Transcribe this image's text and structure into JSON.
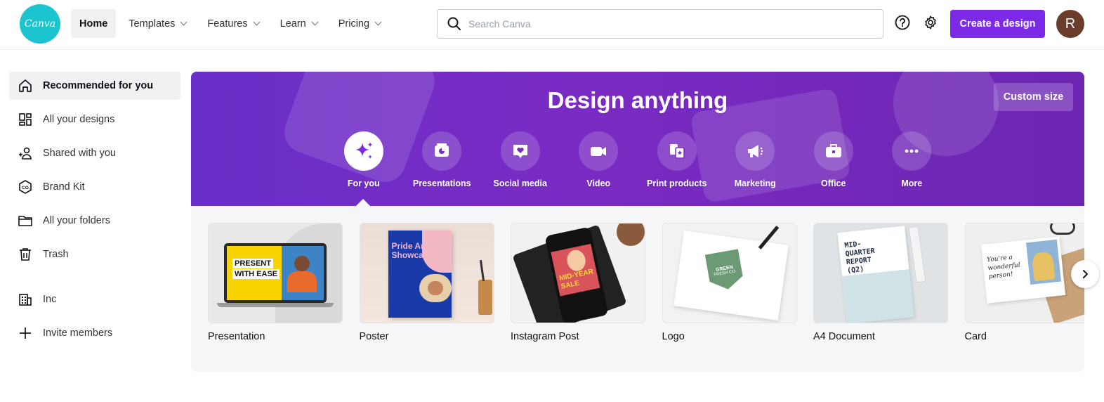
{
  "topbar": {
    "logo_text": "Canva",
    "nav": [
      {
        "label": "Home",
        "active": true,
        "dropdown": false
      },
      {
        "label": "Templates",
        "active": false,
        "dropdown": true
      },
      {
        "label": "Features",
        "active": false,
        "dropdown": true
      },
      {
        "label": "Learn",
        "active": false,
        "dropdown": true
      },
      {
        "label": "Pricing",
        "active": false,
        "dropdown": true
      }
    ],
    "search_placeholder": "Search Canva",
    "help_icon": "question-circle-icon",
    "settings_icon": "gear-icon",
    "create_button": "Create a design",
    "avatar_initial": "R",
    "accent_color": "#7d2ae8"
  },
  "sidebar": {
    "items": [
      {
        "label": "Recommended for you",
        "icon": "home-icon",
        "active": true
      },
      {
        "label": "All your designs",
        "icon": "grid-icon",
        "active": false
      },
      {
        "label": "Shared with you",
        "icon": "shared-users-icon",
        "active": false
      },
      {
        "label": "Brand Kit",
        "icon": "brand-kit-icon",
        "active": false
      },
      {
        "label": "All your folders",
        "icon": "folder-icon",
        "active": false
      },
      {
        "label": "Trash",
        "icon": "trash-icon",
        "active": false
      }
    ],
    "team": [
      {
        "label": "Inc",
        "icon": "building-icon"
      },
      {
        "label": "Invite members",
        "icon": "plus-icon"
      }
    ]
  },
  "hero": {
    "title": "Design anything",
    "custom_size": "Custom size",
    "categories": [
      {
        "label": "For you",
        "icon": "sparkle-icon",
        "active": true
      },
      {
        "label": "Presentations",
        "icon": "presentation-icon",
        "active": false
      },
      {
        "label": "Social media",
        "icon": "heart-bubble-icon",
        "active": false
      },
      {
        "label": "Video",
        "icon": "video-camera-icon",
        "active": false
      },
      {
        "label": "Print products",
        "icon": "print-icon",
        "active": false
      },
      {
        "label": "Marketing",
        "icon": "megaphone-icon",
        "active": false
      },
      {
        "label": "Office",
        "icon": "briefcase-icon",
        "active": false
      },
      {
        "label": "More",
        "icon": "more-dots-icon",
        "active": false
      }
    ]
  },
  "templates": {
    "cards": [
      {
        "label": "Presentation",
        "thumb_text": [
          "PRESENT",
          "WITH EASE"
        ]
      },
      {
        "label": "Poster",
        "thumb_text": [
          "Pride Art",
          "Showcase"
        ]
      },
      {
        "label": "Instagram Post",
        "thumb_text": [
          "MID-YEAR",
          "SALE"
        ]
      },
      {
        "label": "Logo",
        "thumb_text": [
          "GREEN",
          "FRESH CO."
        ]
      },
      {
        "label": "A4 Document",
        "thumb_text": [
          "MID-",
          "QUARTER",
          "REPORT",
          "(Q2)"
        ]
      },
      {
        "label": "Card",
        "thumb_text": [
          "You're a",
          "wonderful",
          "person!"
        ]
      }
    ]
  }
}
